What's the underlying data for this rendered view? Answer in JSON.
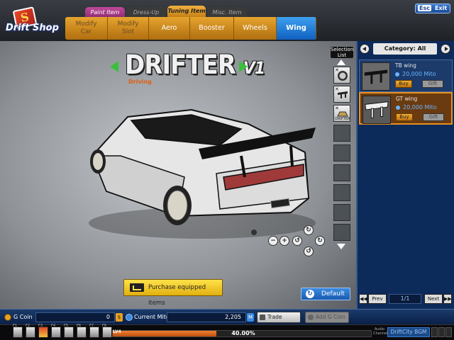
{
  "app": {
    "logo_text": "Drift Shop",
    "logo_badge": "S"
  },
  "top_tabs": [
    {
      "label": "Paint Item"
    },
    {
      "label": "Dress-Up Item"
    },
    {
      "label": "Tuning Item"
    },
    {
      "label": "Misc. Item"
    }
  ],
  "menu": {
    "modify_car": "Modify\nCar",
    "modify_slot": "Modify\nSlot",
    "aero": "Aero",
    "booster": "Booster",
    "wheels": "Wheels",
    "wing": "Wing"
  },
  "esc_button": {
    "key": "Esc",
    "label": "Exit"
  },
  "car": {
    "title": "DRIFTER",
    "version": "V1",
    "subtitle": "Driving"
  },
  "selection_list": {
    "label": "Selection List",
    "slot_tag": "DRIFTER"
  },
  "purchase_button": "Purchase equipped items",
  "default_button": "Default",
  "category": {
    "label": "Category: All"
  },
  "shop_items": [
    {
      "name": "TB wing",
      "price": "20,000 Mito",
      "buy": "Buy",
      "gift": "Gift",
      "selected": false
    },
    {
      "name": "GT wing",
      "price": "20,000 Mito",
      "buy": "Buy",
      "gift": "Gift",
      "selected": true
    }
  ],
  "pager": {
    "prev": "Prev",
    "next": "Next",
    "page": "1/1"
  },
  "currency": {
    "gcoin_label": "G Coin",
    "gcoin_value": "0",
    "gcoin_unit": "$",
    "mito_label": "Current Mito",
    "mito_value": "2,205",
    "mito_unit": "M"
  },
  "trade_history": "Trade History",
  "add_gcoin": "Add G Coin",
  "quickbar": {
    "keys": [
      "F1",
      "F2",
      "F3",
      "F4",
      "F5",
      "F6",
      "F7",
      "F8"
    ],
    "level_tag": "LV4",
    "progress_text": "40.00%",
    "progress": 0.4
  },
  "audio": {
    "label": "Audio Channel",
    "bgm": "DriftCity BGM"
  },
  "colors": {
    "accent": "#e6a42e",
    "selected": "#1a6ad0",
    "panel": "#0c2a5a"
  }
}
